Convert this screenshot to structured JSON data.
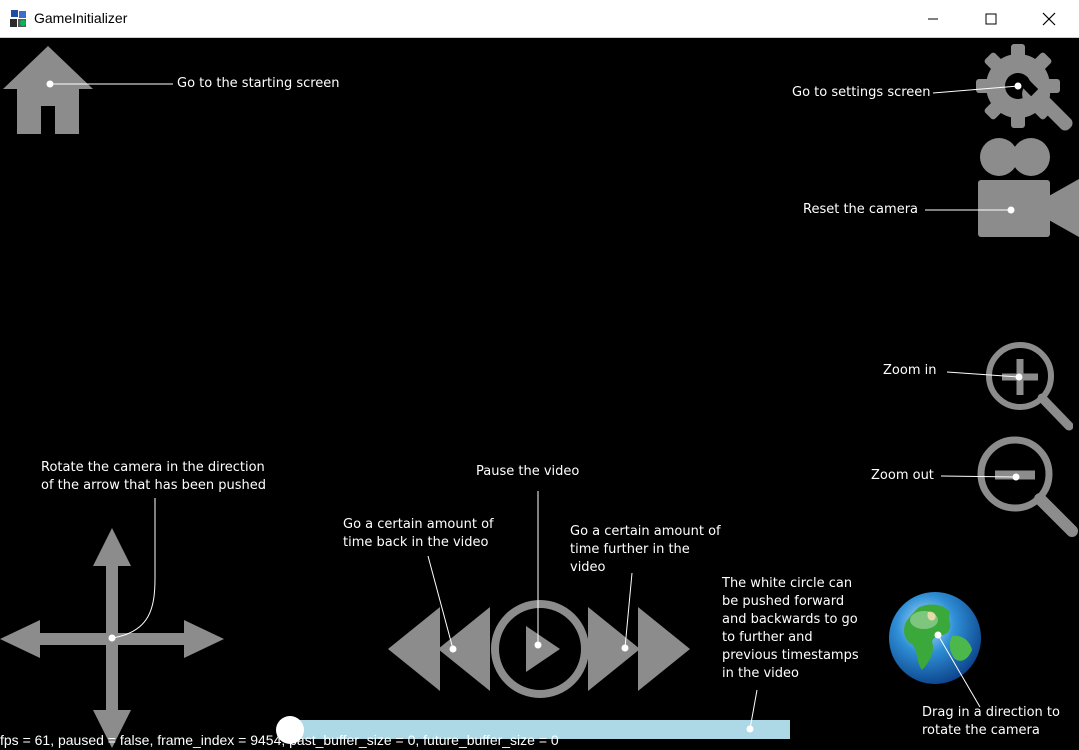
{
  "window": {
    "title": "GameInitializer",
    "controls": {
      "minimize": "minimize-icon",
      "maximize": "maximize-icon",
      "close": "close-icon"
    }
  },
  "controls": {
    "home": "home-icon",
    "settings": "settings-gear-wrench-icon",
    "reset_camera": "video-camera-icon",
    "zoom_in": "zoom-in-icon",
    "zoom_out": "zoom-out-icon",
    "rotate_arrows": "four-way-arrows-icon",
    "rewind": "rewind-icon",
    "play_pause": "play-icon",
    "fast_forward": "fast-forward-icon",
    "globe": "globe-icon"
  },
  "annotations": {
    "home": "Go to the starting screen",
    "settings": "Go to settings screen",
    "reset_camera": "Reset the camera",
    "zoom_in": "Zoom in",
    "zoom_out": "Zoom out",
    "rotate": [
      "Rotate the camera in the direction",
      "of the arrow that has been pushed"
    ],
    "pause": "Pause the video",
    "back": [
      "Go a certain amount of",
      "time back in the video"
    ],
    "forward": [
      "Go a certain amount of",
      "time further in the",
      "video"
    ],
    "slider": [
      "The white circle can",
      "be pushed forward",
      "and backwards to go",
      "to further and",
      "previous timestamps",
      "in the video"
    ],
    "globe": [
      "Drag in a direction to",
      "rotate the camera"
    ]
  },
  "timeline": {
    "progress": 0.0
  },
  "debug": {
    "text": "fps = 61, paused = false, frame_index = 9454, past_buffer_size = 0, future_buffer_size = 0"
  },
  "colors": {
    "icon_gray": "#8c8c8c",
    "slider_track": "#add8e6",
    "annotation": "#ffffff",
    "background": "#000000"
  }
}
